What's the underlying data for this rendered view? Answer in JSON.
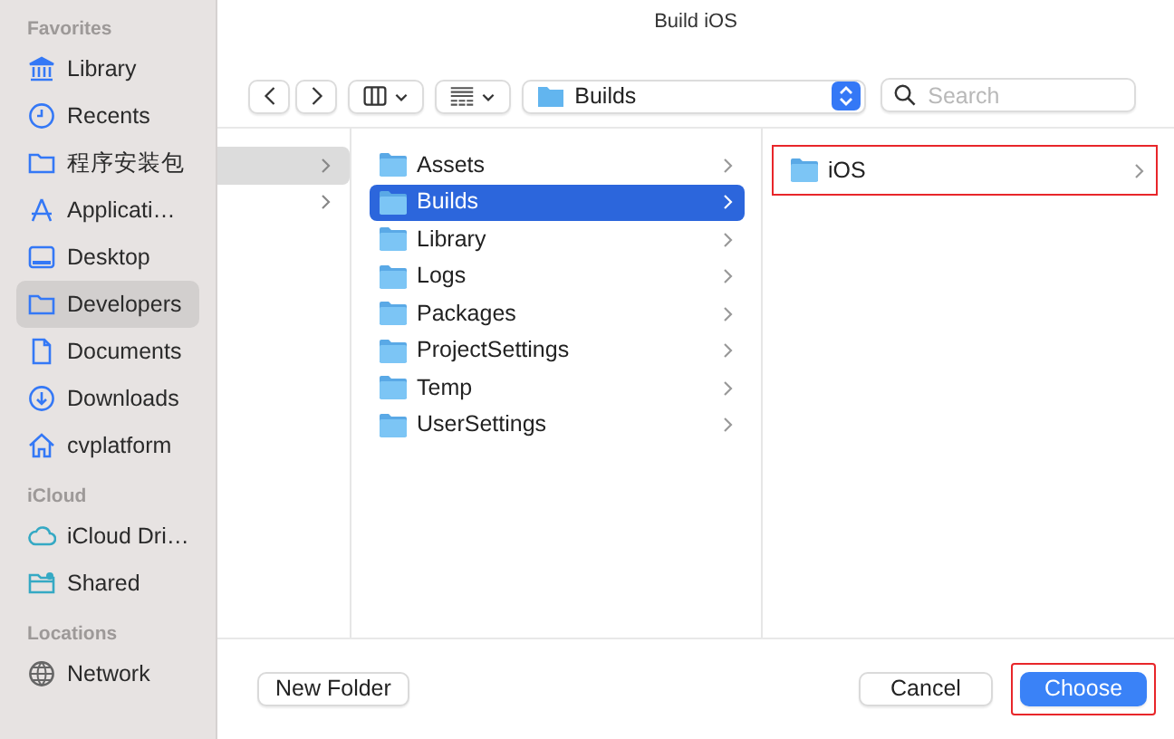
{
  "window": {
    "title": "Build iOS"
  },
  "sidebar": {
    "sections": [
      {
        "heading": "Favorites",
        "items": [
          {
            "label": "Library",
            "selected": false
          },
          {
            "label": "Recents",
            "selected": false
          },
          {
            "label": "程序安装包",
            "selected": false
          },
          {
            "label": "Applicati…",
            "selected": false
          },
          {
            "label": "Desktop",
            "selected": false
          },
          {
            "label": "Developers",
            "selected": true
          },
          {
            "label": "Documents",
            "selected": false
          },
          {
            "label": "Downloads",
            "selected": false
          },
          {
            "label": "cvplatform",
            "selected": false
          }
        ]
      },
      {
        "heading": "iCloud",
        "items": [
          {
            "label": "iCloud Dri…",
            "selected": false
          },
          {
            "label": "Shared",
            "selected": false
          }
        ]
      },
      {
        "heading": "Locations",
        "items": [
          {
            "label": "Network",
            "selected": false
          }
        ]
      }
    ]
  },
  "toolbar": {
    "location": "Builds",
    "search": {
      "placeholder": "Search"
    }
  },
  "column_1": {
    "rows": [
      {
        "selected": true
      },
      {
        "selected": false
      }
    ]
  },
  "column_2": {
    "rows": [
      {
        "label": "Assets",
        "selected": false
      },
      {
        "label": "Builds",
        "selected": true
      },
      {
        "label": "Library",
        "selected": false
      },
      {
        "label": "Logs",
        "selected": false
      },
      {
        "label": "Packages",
        "selected": false
      },
      {
        "label": "ProjectSettings",
        "selected": false
      },
      {
        "label": "Temp",
        "selected": false
      },
      {
        "label": "UserSettings",
        "selected": false
      }
    ]
  },
  "column_3": {
    "rows": [
      {
        "label": "iOS",
        "selected": false,
        "highlighted": true
      }
    ]
  },
  "buttons": [
    {
      "label": "New Folder",
      "kind": "plain",
      "highlighted": false
    },
    {
      "label": "Cancel",
      "kind": "plain",
      "highlighted": false
    },
    {
      "label": "Choose",
      "kind": "default",
      "highlighted": true
    }
  ]
}
